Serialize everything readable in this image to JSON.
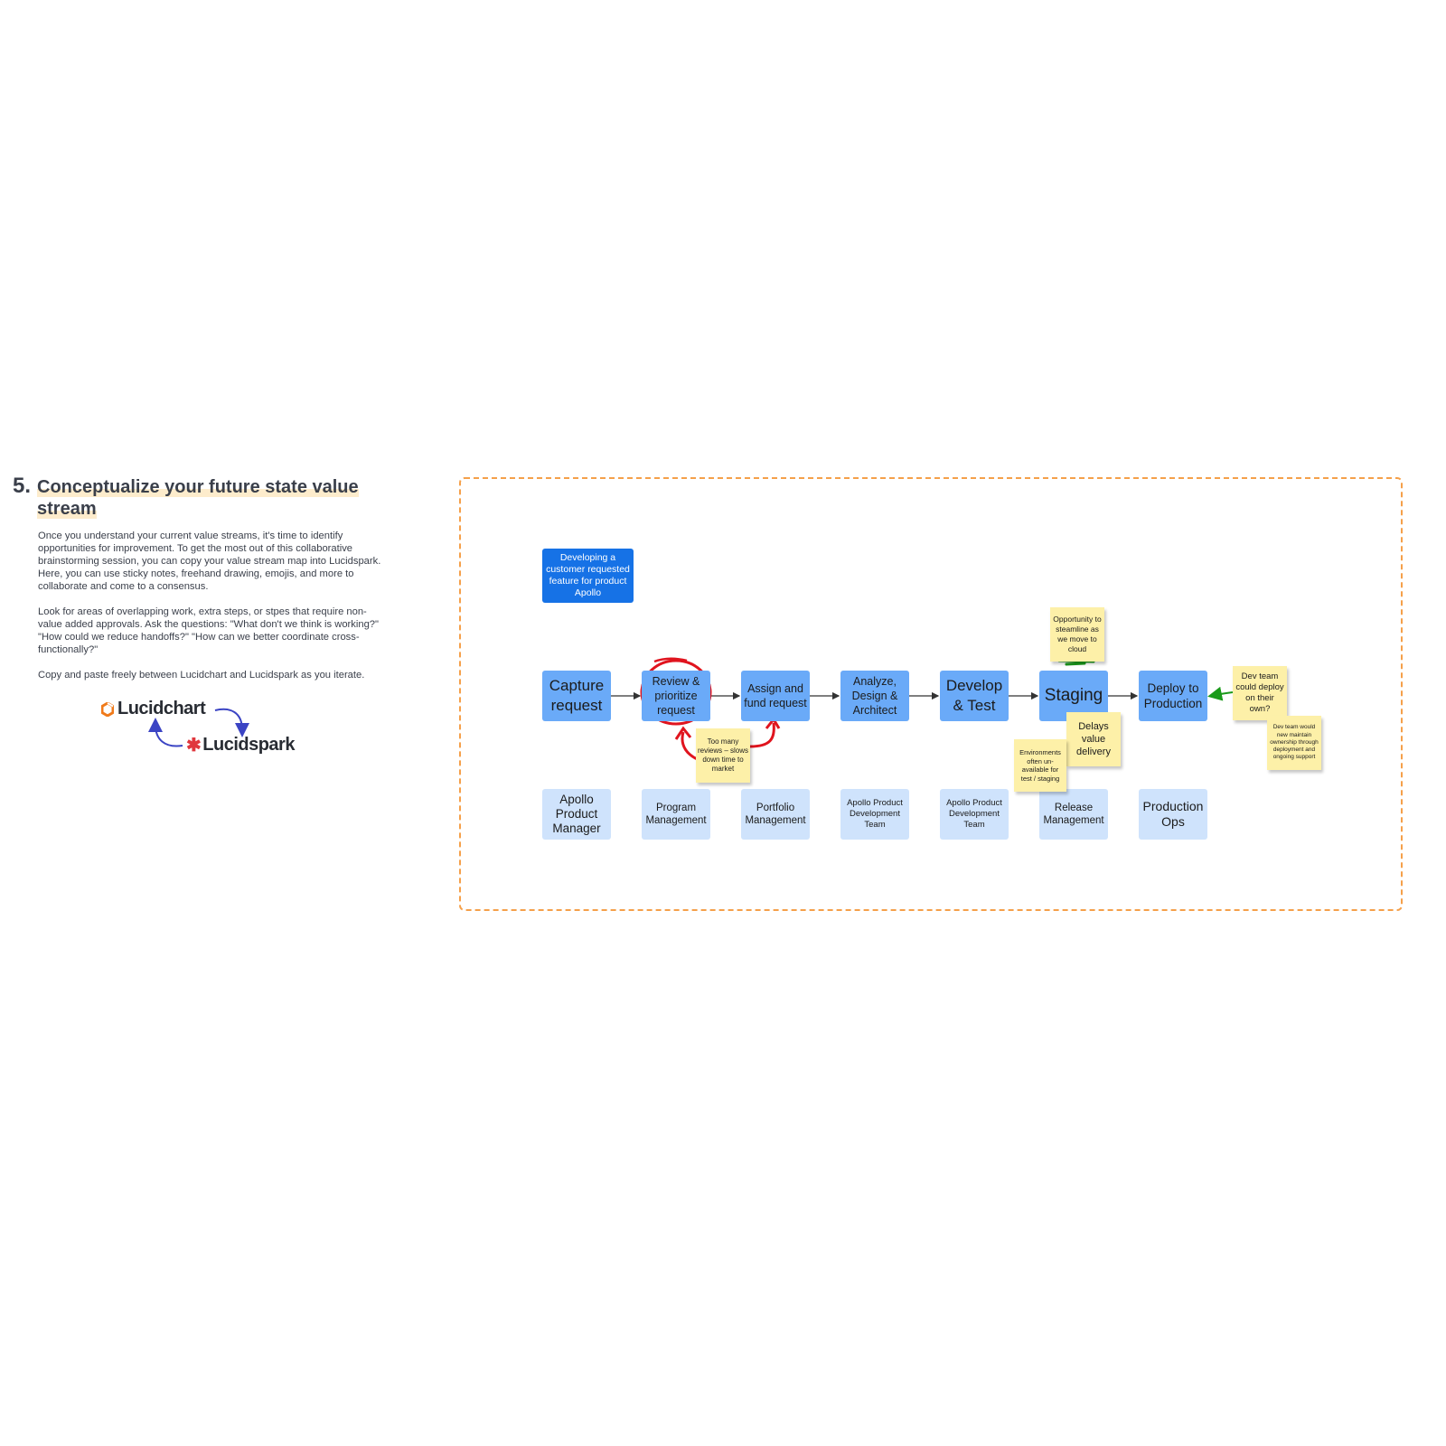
{
  "section": {
    "number": "5.",
    "title": "Conceptualize your future state value stream",
    "paragraphs": [
      "Once you understand your current value streams, it's time to identify opportunities for improvement. To get the most out of this collaborative brainstorming session, you can copy your value stream map into Lucidspark. Here, you can use sticky notes, freehand drawing, emojis, and more to collaborate and come to a consensus.",
      "Look for areas of overlapping work, extra steps, or stpes that require non-value added approvals. Ask the questions: \"What don't we think is working?\" \"How could we reduce handoffs?\" \"How can we better coordinate cross-functionally?\"",
      "Copy and paste freely between Lucidchart and Lucidspark as you iterate."
    ],
    "logos": {
      "lucidchart": "Lucidchart",
      "lucidspark": "Lucidspark"
    }
  },
  "diagram": {
    "header": "Developing a customer requested feature for product Apollo",
    "process_steps": [
      "Capture request",
      "Review & prioritize request",
      "Assign and fund request",
      "Analyze, Design & Architect",
      "Develop & Test",
      "Staging",
      "Deploy to Production"
    ],
    "actors": [
      "Apollo Product Manager",
      "Program Management",
      "Portfolio Management",
      "Apollo Product Development Team",
      "Apollo Product Development Team",
      "Release Management",
      "Production Ops"
    ],
    "stickies": {
      "reviews": "Too many reviews – slows down time to market",
      "cloud": "Opportunity to steamline as we move to cloud",
      "delays": "Delays value delivery",
      "environments": "Environments often un-available for test / staging",
      "dev_deploy": "Dev team could deploy on their own?",
      "ownership": "Dev team would new maintain ownership through deployment and ongoing support"
    },
    "colors": {
      "process": "#6aaaf8",
      "actor": "#cfe3fc",
      "header": "#1672e6",
      "sticky": "#fdf0a8",
      "frame": "#f5a04a",
      "annotation_red": "#e0141e",
      "annotation_green": "#1a9a1a"
    }
  }
}
